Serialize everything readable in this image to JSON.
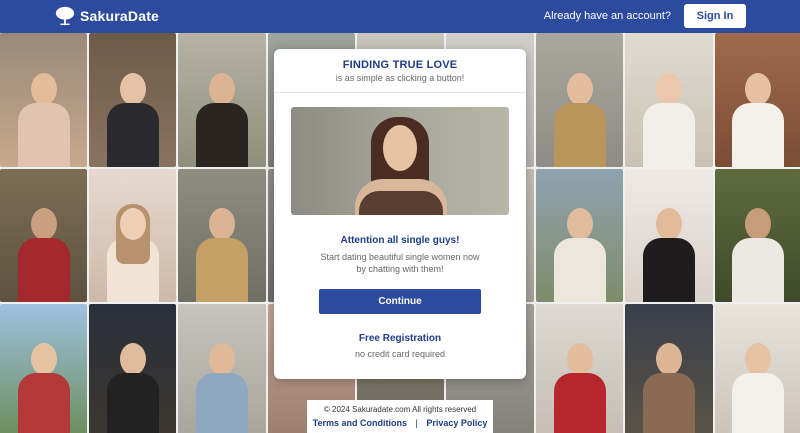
{
  "header": {
    "logo_text": "SakuraDate",
    "have_account": "Already have an account?",
    "signin_label": "Sign In"
  },
  "modal": {
    "title": "FINDING TRUE LOVE",
    "subtitle": "is as simple as clicking a button!",
    "attention": "Attention all single guys!",
    "desc_line1": "Start dating beautiful single women now",
    "desc_line2": "by chatting with them!",
    "continue_label": "Continue",
    "free_registration": "Free Registration",
    "no_card": "no credit card required"
  },
  "footer": {
    "copyright": "© 2024 Sakuradate.com All rights reserved",
    "terms_label": "Terms and Conditions",
    "separator": "|",
    "privacy_label": "Privacy Policy"
  },
  "colors": {
    "brand": "#2d4b9e",
    "brand_text": "#1f3c88"
  }
}
